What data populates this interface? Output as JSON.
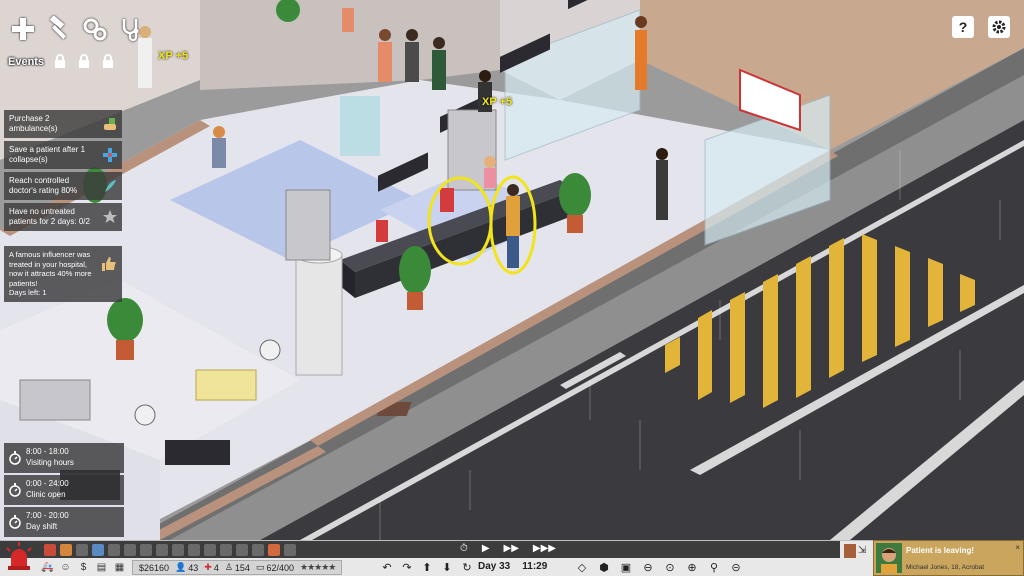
{
  "toolbar": {
    "items": [
      {
        "name": "build",
        "icon": "plus-icon"
      },
      {
        "name": "tools",
        "icon": "hammer-icon"
      },
      {
        "name": "management",
        "icon": "gears-icon"
      },
      {
        "name": "staff",
        "icon": "stethoscope-icon"
      }
    ]
  },
  "events_label": "Events",
  "objectives": [
    {
      "text": "Purchase 2 ambulance(s)",
      "icon": "hand-money-icon"
    },
    {
      "text": "Save a patient after 1 collapse(s)",
      "icon": "medical-cross-icon"
    },
    {
      "text": "Reach controlled doctor's rating 80%",
      "icon": "feather-icon"
    },
    {
      "text": "Have no untreated patients for 2 days: 0/2",
      "icon": "star-icon"
    }
  ],
  "influencer": {
    "text": "A famous influencer was treated in your hospital, now it attracts 40% more patients!",
    "days_left": "Days left: 1",
    "icon": "thumbs-up-icon"
  },
  "xp_popups": [
    "XP +5",
    "XP +5"
  ],
  "schedule": [
    {
      "time": "8:00 - 18:00",
      "label": "Visiting hours"
    },
    {
      "time": "0:00 - 24:00",
      "label": "Clinic open"
    },
    {
      "time": "7:00 - 20:00",
      "label": "Day shift"
    }
  ],
  "top_right": {
    "help": "?",
    "settings_icon": "gear-icon"
  },
  "bottom": {
    "stats": {
      "money": "$26160",
      "staff_count": "43",
      "doctors": "4",
      "patients": "154",
      "capacity": "62/400",
      "stars": "★★★★★"
    },
    "day": "Day 33",
    "time": "11:29",
    "speed_controls": [
      "play",
      "fast",
      "faster"
    ]
  },
  "toast": {
    "title": "Patient is leaving!",
    "subtitle": "Michael Jones, 18, Acrobat"
  },
  "colors": {
    "floor_tile": "#e4e4ec",
    "wall": "#b9927e",
    "road": "#3b3b3f",
    "stripe": "#e2b53a",
    "highlight": "#f2e41c",
    "toast_bg": "#c9a55e"
  }
}
